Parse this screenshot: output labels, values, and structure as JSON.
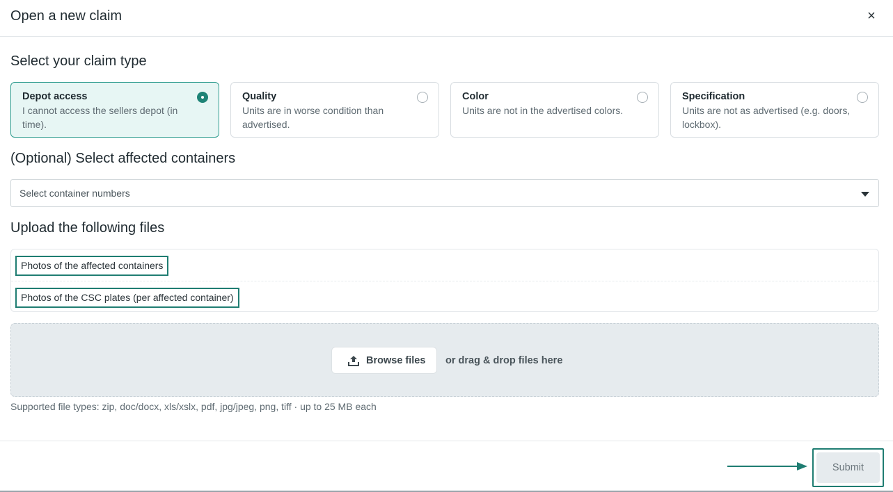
{
  "header": {
    "title": "Open a new claim",
    "close_symbol": "×"
  },
  "claim_type": {
    "heading": "Select your claim type",
    "options": [
      {
        "title": "Depot access",
        "description": "I cannot access the sellers depot (in time).",
        "selected": true
      },
      {
        "title": "Quality",
        "description": "Units are in worse condition than advertised.",
        "selected": false
      },
      {
        "title": "Color",
        "description": "Units are not in the advertised colors.",
        "selected": false
      },
      {
        "title": "Specification",
        "description": "Units are not as advertised (e.g. doors, lockbox).",
        "selected": false
      }
    ]
  },
  "containers": {
    "heading": "(Optional) Select affected containers",
    "placeholder": "Select container numbers"
  },
  "upload": {
    "heading": "Upload the following files",
    "required_files": [
      "Photos of the affected containers",
      "Photos of the CSC plates (per affected container)"
    ],
    "browse_label": "Browse files",
    "drag_text": "or drag & drop files here",
    "supported_text": "Supported file types: zip, doc/docx, xls/xslx, pdf, jpg/jpeg, png, tiff · up to 25 MB each"
  },
  "footer": {
    "submit_label": "Submit"
  },
  "colors": {
    "accent": "#1e8376",
    "highlight_border": "#1f7d72",
    "selected_card_bg": "#e7f6f4",
    "dropzone_bg": "#e6ebee"
  }
}
